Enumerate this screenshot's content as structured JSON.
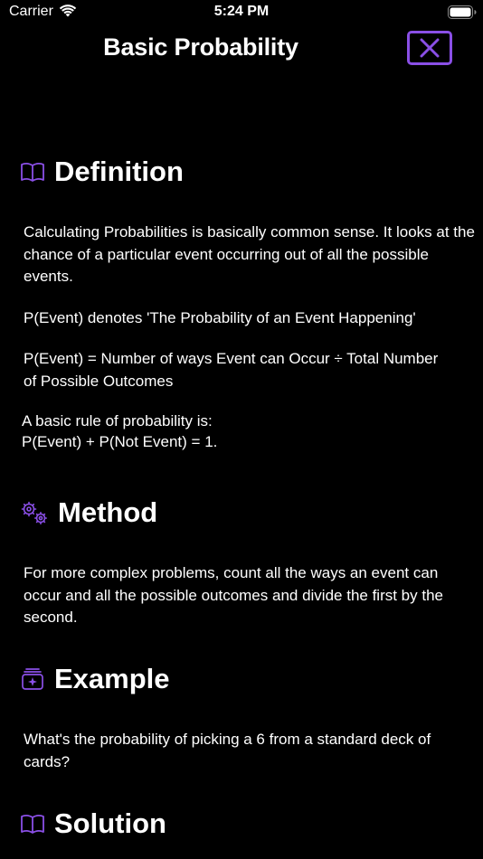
{
  "status_bar": {
    "carrier": "Carrier",
    "time": "5:24 PM"
  },
  "header": {
    "title": "Basic Probability",
    "close_icon": "close-icon"
  },
  "sections": {
    "definition": {
      "icon": "book-icon",
      "title": "Definition",
      "p1": "Calculating Probabilities is basically common sense. It looks at the chance of a particular event occurring out of all the possible events.",
      "p2": "P(Event) denotes 'The Probability of an Event Happening'",
      "p3": "P(Event) = Number of ways Event can Occur ÷ Total Number of Possible Outcomes",
      "p4_line1": "A basic rule of probability is:",
      "p4_line2": "P(Event) + P(Not Event) = 1."
    },
    "method": {
      "icon": "gears-icon",
      "title": "Method",
      "p1": "For more complex problems, count all the ways an event can occur and all the possible outcomes and divide the first by the second."
    },
    "example": {
      "icon": "sparkle-stack-icon",
      "title": "Example",
      "p1": "What's the probability of picking a 6  from a standard deck of cards?"
    },
    "solution": {
      "icon": "book-icon",
      "title": "Solution"
    }
  },
  "colors": {
    "accent": "#8a4fe6",
    "background": "#000000",
    "text": "#ffffff"
  }
}
